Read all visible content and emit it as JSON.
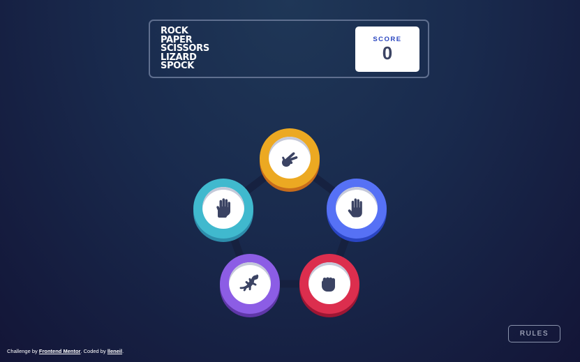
{
  "header": {
    "title_lines": [
      "ROCK",
      "PAPER",
      "SCISSORS",
      "LIZARD",
      "SPOCK"
    ],
    "score_label": "SCORE",
    "score_value": "0"
  },
  "tokens": [
    {
      "name": "scissors",
      "icon": "scissors-icon",
      "color": "#eca922"
    },
    {
      "name": "spock",
      "icon": "spock-icon",
      "color": "#40b9ce"
    },
    {
      "name": "paper",
      "icon": "paper-icon",
      "color": "#5671f5"
    },
    {
      "name": "lizard",
      "icon": "lizard-icon",
      "color": "#8c5de5"
    },
    {
      "name": "rock",
      "icon": "rock-icon",
      "color": "#dc2e4e"
    }
  ],
  "rules_button": {
    "label": "RULES"
  },
  "attribution": {
    "prefix": "Challenge by ",
    "link1": "Frontend Mentor",
    "middle": ". Coded by ",
    "link2": "lleneil",
    "suffix": "."
  }
}
